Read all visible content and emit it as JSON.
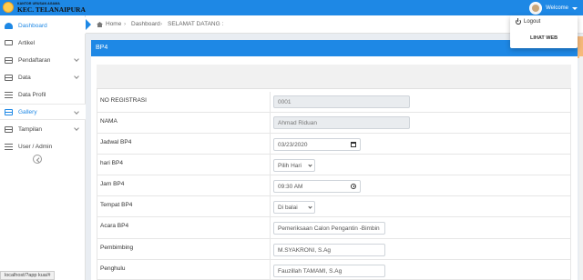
{
  "brand": {
    "subtitle": "KANTOR URUSAN AGAMA",
    "name": "KEC. TELANAIPURA"
  },
  "user": {
    "welcome": "Welcome"
  },
  "dropdown": {
    "logout": "Logout",
    "lihat_web": "LIHAT WEB"
  },
  "sidebar": {
    "items": [
      {
        "label": "Dashboard",
        "icon": "dashboard-icon"
      },
      {
        "label": "Artikel",
        "icon": "monitor-icon"
      },
      {
        "label": "Pendaftaran",
        "icon": "grid-icon"
      },
      {
        "label": "Data",
        "icon": "grid-icon"
      },
      {
        "label": "Data Profil",
        "icon": "list-icon"
      },
      {
        "label": "Gallery",
        "icon": "grid-icon"
      },
      {
        "label": "Tampilan",
        "icon": "grid-icon"
      },
      {
        "label": "User / Admin",
        "icon": "list-icon"
      }
    ]
  },
  "status_url": "localhost/?app kua/#",
  "breadcrumb": {
    "home": "Home",
    "sep": "›",
    "dashboard": "Dashboard",
    "current": "SELAMAT DATANG :"
  },
  "card": {
    "title": "BP4"
  },
  "form": {
    "no_registrasi": {
      "label": "NO REGISTRASI",
      "value": "0001"
    },
    "nama": {
      "label": "NAMA",
      "value": "Ahmad Riduan"
    },
    "jadwal": {
      "label": "Jadwal BP4",
      "value": "03/23/2020"
    },
    "hari": {
      "label": "hari BP4",
      "value": "Pilih Hari"
    },
    "jam": {
      "label": "Jam BP4",
      "value": "09:30 AM"
    },
    "tempat": {
      "label": "Tempat BP4",
      "value": "Di balai"
    },
    "acara": {
      "label": "Acara BP4",
      "value": "Pemeriksaan Calon Pengantin -Bimbin"
    },
    "pembimbing": {
      "label": "Pembimbing",
      "value": "M.SYAKRONI, S.Ag"
    },
    "penghulu": {
      "label": "Penghulu",
      "value": "Fauzillah TAMAMI, S.Ag"
    }
  }
}
